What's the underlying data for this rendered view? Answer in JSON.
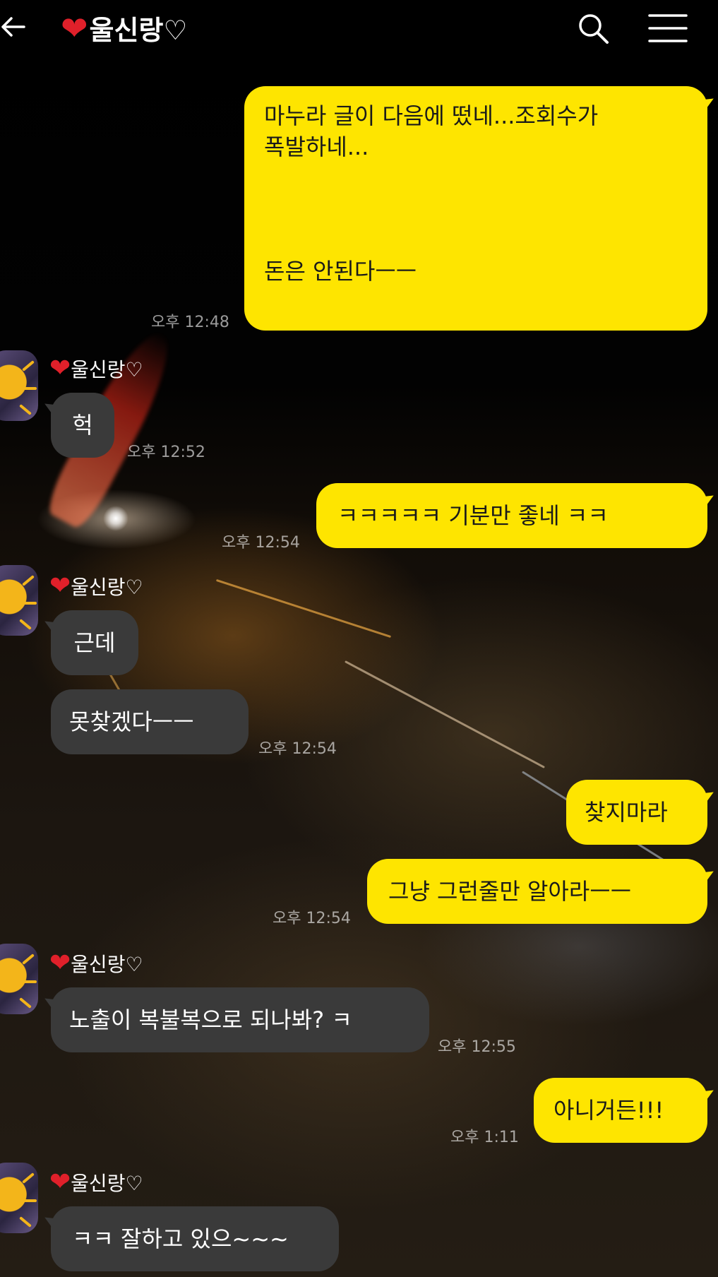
{
  "header": {
    "title": "울신랑♡",
    "back_icon": "back-arrow-icon",
    "search_icon": "search-icon",
    "menu_icon": "hamburger-menu-icon"
  },
  "colors": {
    "my_bubble": "#fee500",
    "their_bubble": "#3a3a3a",
    "heart": "#e0202a"
  },
  "messages": [
    {
      "from": "me",
      "text": "마누라 글이 다음에 떴네...조회수가\n폭발하네...\n\n\n\n돈은 안된다ㅡㅡ",
      "time": "오후 12:48"
    },
    {
      "from": "them",
      "sender": "울신랑♡",
      "text": "헉",
      "time": "오후 12:52"
    },
    {
      "from": "me",
      "text": "ㅋㅋㅋㅋㅋ 기분만 좋네 ㅋㅋ",
      "time": "오후 12:54"
    },
    {
      "from": "them",
      "sender": "울신랑♡",
      "text": "근데",
      "time": ""
    },
    {
      "from": "them",
      "text": "못찾겠다ㅡㅡ",
      "time": "오후 12:54"
    },
    {
      "from": "me",
      "text": "찾지마라",
      "time": ""
    },
    {
      "from": "me",
      "text": "그냥 그런줄만 알아라ㅡㅡ",
      "time": "오후 12:54"
    },
    {
      "from": "them",
      "sender": "울신랑♡",
      "text": "노출이 복불복으로 되나봐? ㅋ",
      "time": "오후 12:55"
    },
    {
      "from": "me",
      "text": "아니거든!!!",
      "time": "오후 1:11"
    },
    {
      "from": "them",
      "sender": "울신랑♡",
      "text": "ㅋㅋ 잘하고 있으~~~",
      "time": ""
    }
  ]
}
